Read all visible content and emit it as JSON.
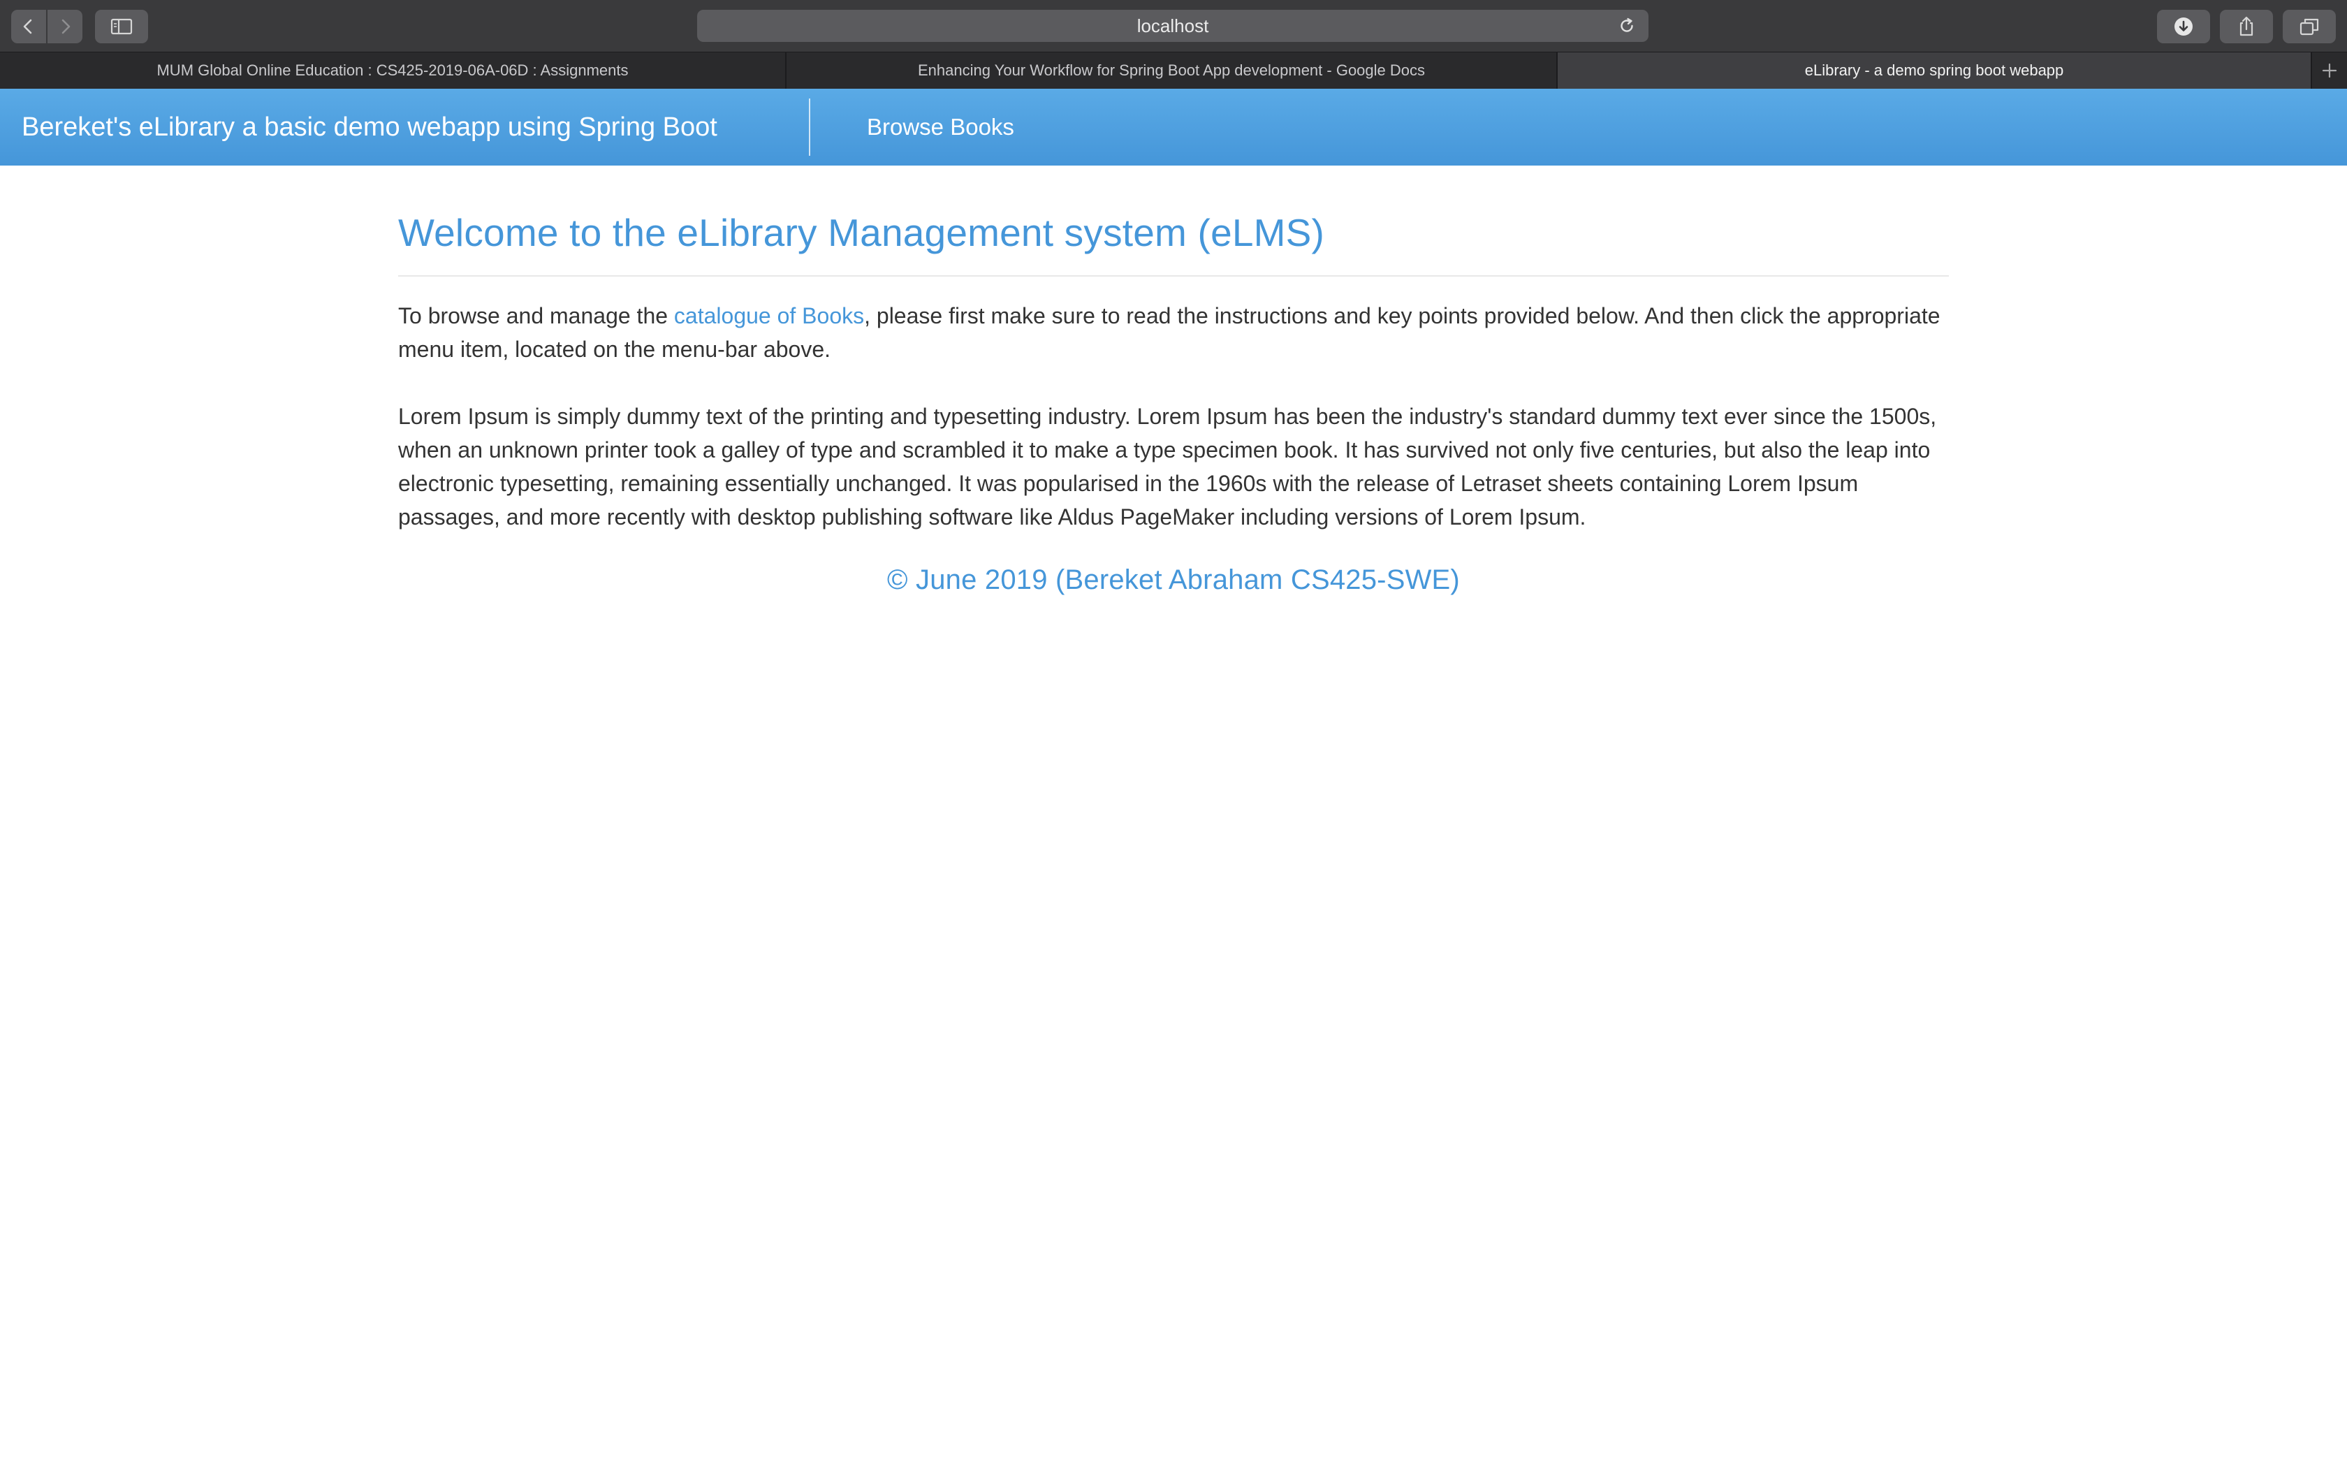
{
  "browser": {
    "url": "localhost",
    "tabs": [
      {
        "label": "MUM Global Online Education : CS425-2019-06A-06D : Assignments",
        "active": false
      },
      {
        "label": "Enhancing Your Workflow for Spring Boot App development - Google Docs",
        "active": false
      },
      {
        "label": "eLibrary - a demo spring boot webapp",
        "active": true
      }
    ],
    "icons": {
      "back": "chevron-left-icon",
      "forward": "chevron-right-icon",
      "sidebar": "sidebar-icon",
      "reload": "reload-icon",
      "downloads": "download-icon",
      "share": "share-icon",
      "tabs_overview": "tabs-overview-icon",
      "new_tab": "plus-icon"
    }
  },
  "navbar": {
    "brand": "Bereket's eLibrary a basic demo webapp using Spring Boot",
    "links": [
      {
        "label": "Browse Books"
      }
    ],
    "color": "#4a9bdc"
  },
  "main": {
    "title": "Welcome to the eLibrary Management system (eLMS)",
    "intro": {
      "before_link": "To browse and manage the ",
      "link": "catalogue of Books",
      "after_link": ", please first make sure to read the instructions and key points provided below. And then click the appropriate menu item, located on the menu-bar above."
    },
    "lorem": "Lorem Ipsum is simply dummy text of the printing and typesetting industry. Lorem Ipsum has been the industry's standard dummy text ever since the 1500s, when an unknown printer took a galley of type and scrambled it to make a type specimen book. It has survived not only five centuries, but also the leap into electronic typesetting, remaining essentially unchanged. It was popularised in the 1960s with the release of Letraset sheets containing Lorem Ipsum passages, and more recently with desktop publishing software like Aldus PageMaker including versions of Lorem Ipsum.",
    "footer": "© June 2019 (Bereket Abraham CS425-SWE)"
  },
  "colors": {
    "accent": "#4596d9",
    "text": "#333333",
    "toolbar": "#3a3a3c"
  }
}
